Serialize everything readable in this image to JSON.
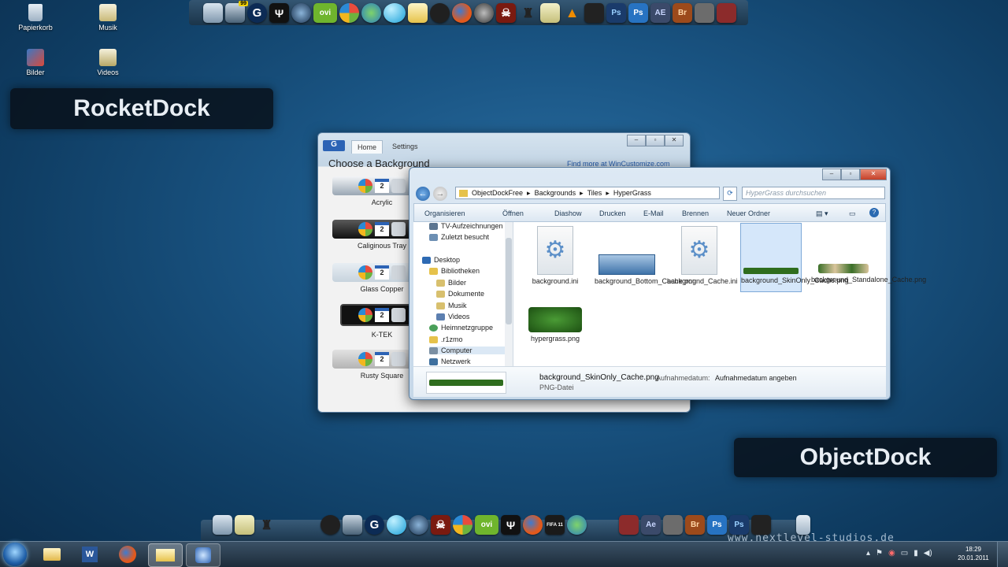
{
  "desktop_icons": [
    {
      "label": "Papierkorb"
    },
    {
      "label": "Musik"
    },
    {
      "label": "Bilder"
    },
    {
      "label": "Videos"
    }
  ],
  "labels": {
    "rocketdock": "RocketDock",
    "objectdock": "ObjectDock"
  },
  "top_dock": {
    "badge": "99",
    "ovi": "ovi",
    "ps1": "Ps",
    "ps2": "Ps",
    "ae": "AE",
    "br": "Br"
  },
  "bottom_dock": {
    "ovi": "ovi",
    "ae": "Ae",
    "br": "Br",
    "ps1": "Ps",
    "ps2": "Ps",
    "fifa": "FIFA 11"
  },
  "objectdock_window": {
    "tabs": [
      "Home",
      "Settings"
    ],
    "heading": "Choose a Background",
    "link": "Find more at WinCustomize.com",
    "backgrounds": [
      "Acrylic",
      "Caliginous Tray",
      "Glass Copper",
      "K-TEK",
      "Rusty Square"
    ],
    "calendar_day": "2"
  },
  "explorer": {
    "breadcrumb": [
      "ObjectDockFree",
      "Backgrounds",
      "Tiles",
      "HyperGrass"
    ],
    "search_placeholder": "HyperGrass durchsuchen",
    "toolbar": [
      "Organisieren",
      "Öffnen",
      "Diashow",
      "Drucken",
      "E-Mail",
      "Brennen",
      "Neuer Ordner"
    ],
    "nav": [
      "TV-Aufzeichnungen",
      "Zuletzt besucht",
      "Desktop",
      "Bibliotheken",
      "Bilder",
      "Dokumente",
      "Musik",
      "Videos",
      "Heimnetzgruppe",
      ".r1zmo",
      "Computer",
      "Netzwerk"
    ],
    "files": [
      {
        "name": "background.ini",
        "type": "ini"
      },
      {
        "name": "background_Bottom_Cache.png",
        "type": "png-icons"
      },
      {
        "name": "background_Cache.ini",
        "type": "ini"
      },
      {
        "name": "background_SkinOnly_Cache.png",
        "type": "png-grass",
        "selected": true
      },
      {
        "name": "background_Standalone_Cache.png",
        "type": "png-icons-small"
      },
      {
        "name": "hypergrass.png",
        "type": "png-big"
      }
    ],
    "details": {
      "filename": "background_SkinOnly_Cache.png",
      "date_label": "Aufnahmedatum:",
      "date_value": "Aufnahmedatum angeben",
      "type": "PNG-Datei"
    }
  },
  "watermark": "www.nextlevel-studios.de",
  "clock": {
    "time": "18:29",
    "date": "20.01.2011"
  }
}
